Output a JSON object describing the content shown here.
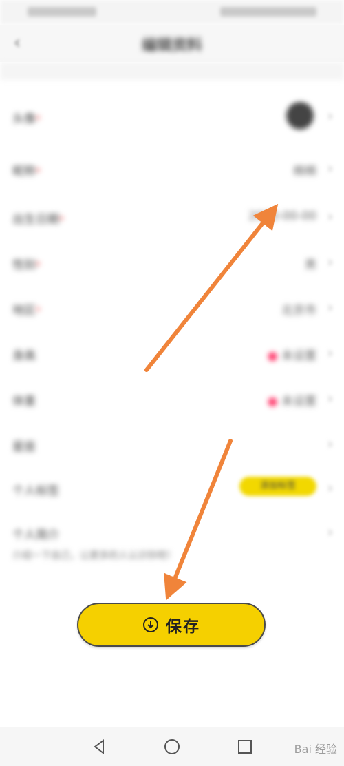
{
  "header": {
    "back_icon": "chevron-left-icon",
    "title": "编辑资料"
  },
  "form": {
    "rows": [
      {
        "label": "头像",
        "required": true,
        "value": "",
        "type": "avatar"
      },
      {
        "label": "昵称",
        "required": true,
        "value": "棉棉",
        "type": "text"
      },
      {
        "label": "出生日期",
        "required": true,
        "value": "2000-00-00",
        "type": "text"
      },
      {
        "label": "性别",
        "required": true,
        "value": "男",
        "type": "text"
      },
      {
        "label": "地区",
        "required": true,
        "value": "北京市",
        "type": "text"
      },
      {
        "label": "身高",
        "required": false,
        "value": "未设置",
        "type": "text"
      },
      {
        "label": "体重",
        "required": false,
        "value": "未设置",
        "type": "text"
      },
      {
        "label": "星座",
        "required": false,
        "value": "",
        "type": "text"
      },
      {
        "label": "个人标签",
        "required": false,
        "value": "添加标签",
        "type": "tag"
      },
      {
        "label": "个人简介",
        "required": false,
        "value": "",
        "type": "intro"
      }
    ],
    "intro_placeholder": "介绍一下自己，让更多的人认识你吧！"
  },
  "save_button": {
    "label": "保存",
    "icon": "download-circle-icon",
    "color": "#f5d000"
  },
  "nav": {
    "back_icon": "triangle-back-icon",
    "home_icon": "circle-home-icon",
    "recents_icon": "square-recents-icon"
  },
  "watermark": "Bai 经验",
  "annotations": {
    "arrow_color": "#f0843a"
  }
}
